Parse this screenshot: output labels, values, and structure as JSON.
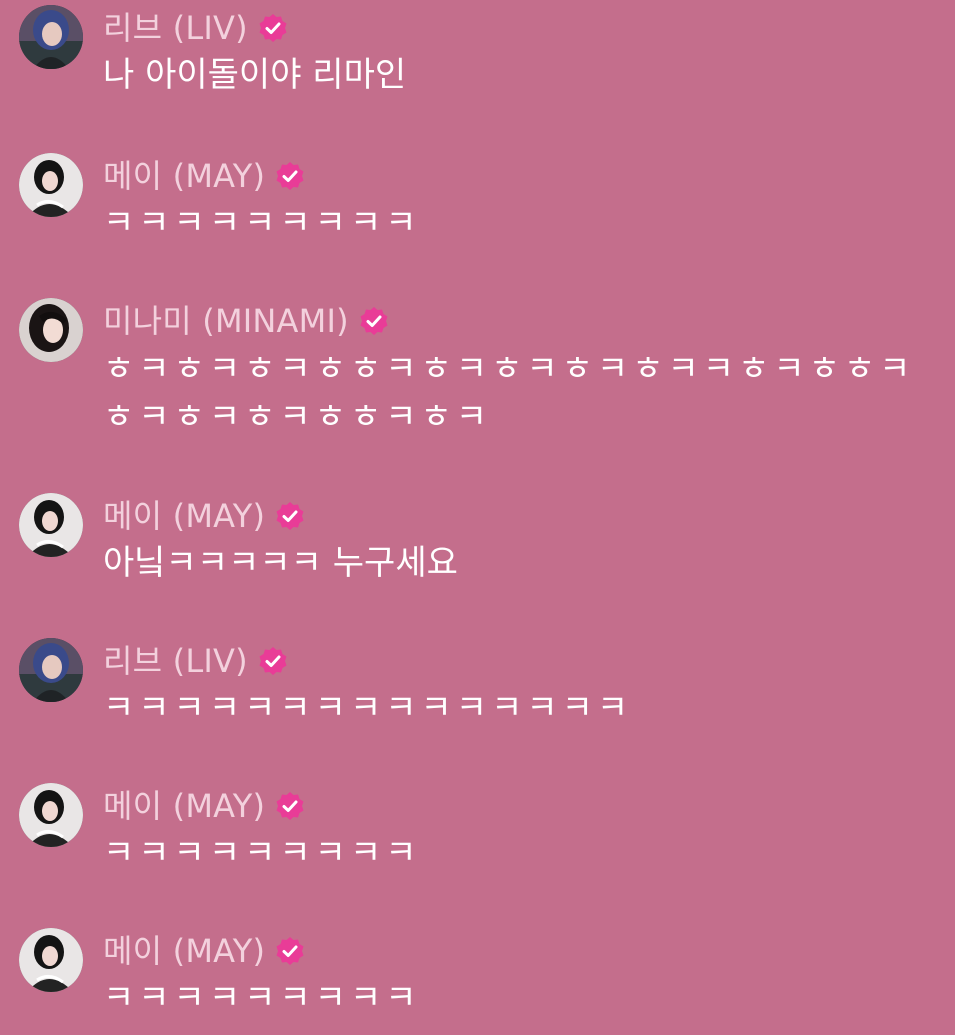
{
  "colors": {
    "background": "#c46e8c",
    "name_text": "#f3d1dd",
    "message_text": "#ffffff",
    "verified_badge": "#e93c97"
  },
  "messages": [
    {
      "author": "리브 (LIV)",
      "avatar": "liv",
      "verified": true,
      "text": "나 아이돌이야 리마인"
    },
    {
      "author": "메이 (MAY)",
      "avatar": "may",
      "verified": true,
      "text": "ㅋㅋㅋㅋㅋㅋㅋㅋㅋ"
    },
    {
      "author": "미나미 (MINAMI)",
      "avatar": "minami",
      "verified": true,
      "text": "ㅎㅋㅎㅋㅎㅋㅎㅎㅋㅎㅋㅎㅋㅎㅋㅎㅋㅋㅎㅋㅎㅎㅋㅎㅋㅎㅋㅎㅋㅎㅎㅋㅎㅋ"
    },
    {
      "author": "메이 (MAY)",
      "avatar": "may",
      "verified": true,
      "text": "아닠ㅋㅋㅋㅋㅋ 누구세요"
    },
    {
      "author": "리브 (LIV)",
      "avatar": "liv",
      "verified": true,
      "text": "ㅋㅋㅋㅋㅋㅋㅋㅋㅋㅋㅋㅋㅋㅋㅋ"
    },
    {
      "author": "메이 (MAY)",
      "avatar": "may",
      "verified": true,
      "text": "ㅋㅋㅋㅋㅋㅋㅋㅋㅋ"
    },
    {
      "author": "메이 (MAY)",
      "avatar": "may",
      "verified": true,
      "text": "ㅋㅋㅋㅋㅋㅋㅋㅋㅋ"
    }
  ]
}
